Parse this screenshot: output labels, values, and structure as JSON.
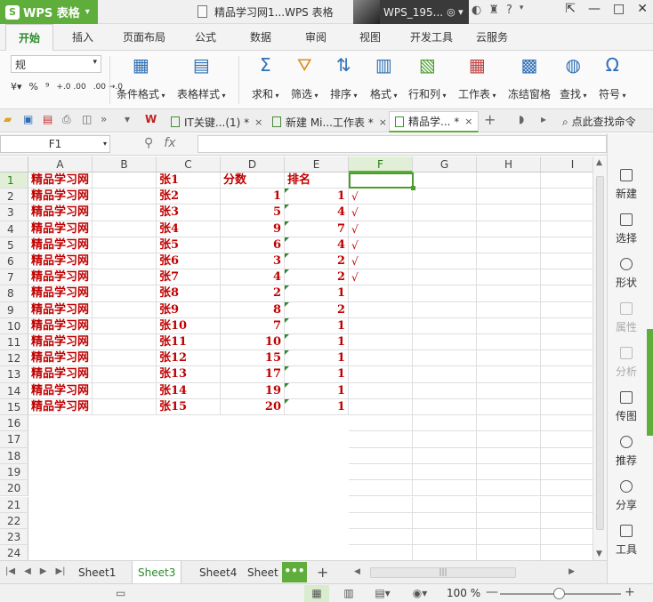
{
  "app": {
    "name": "WPS 表格",
    "doc_title": "精品学习网1...WPS 表格",
    "user": "WPS_195..."
  },
  "ribbon_tabs": [
    "开始",
    "插入",
    "页面布局",
    "公式",
    "数据",
    "审阅",
    "视图",
    "开发工具",
    "云服务"
  ],
  "ribbon": {
    "number_format": "规",
    "num_tools": [
      "%",
      "⁹",
      "+.0 .00",
      ".00 →.0"
    ],
    "buttons": [
      "条件格式",
      "表格样式",
      "求和",
      "筛选",
      "排序",
      "格式",
      "行和列",
      "工作表",
      "冻结窗格",
      "查找",
      "符号"
    ]
  },
  "doc_tabs": [
    {
      "label": "IT关键...(1) *",
      "close": "×"
    },
    {
      "label": "新建 Mi...工作表 *",
      "close": "×"
    },
    {
      "label": "精品学... *",
      "close": "×"
    }
  ],
  "search_cmd": "点此查找命令",
  "formula_bar": {
    "name_box": "F1",
    "fx": "fx",
    "value": ""
  },
  "columns": [
    "A",
    "B",
    "C",
    "D",
    "E",
    "F",
    "G",
    "H",
    "I"
  ],
  "selected_column": "F",
  "rows": [
    {
      "n": "1",
      "a": "精品学习网",
      "c": "张1",
      "d": "分数",
      "e": "排名",
      "f": ""
    },
    {
      "n": "2",
      "a": "精品学习网",
      "c": "张2",
      "d": "1",
      "e": "1",
      "f": "√"
    },
    {
      "n": "3",
      "a": "精品学习网",
      "c": "张3",
      "d": "5",
      "e": "4",
      "f": "√"
    },
    {
      "n": "4",
      "a": "精品学习网",
      "c": "张4",
      "d": "9",
      "e": "7",
      "f": "√"
    },
    {
      "n": "5",
      "a": "精品学习网",
      "c": "张5",
      "d": "6",
      "e": "4",
      "f": "√"
    },
    {
      "n": "6",
      "a": "精品学习网",
      "c": "张6",
      "d": "3",
      "e": "2",
      "f": "√"
    },
    {
      "n": "7",
      "a": "精品学习网",
      "c": "张7",
      "d": "4",
      "e": "2",
      "f": "√"
    },
    {
      "n": "8",
      "a": "精品学习网",
      "c": "张8",
      "d": "2",
      "e": "1",
      "f": ""
    },
    {
      "n": "9",
      "a": "精品学习网",
      "c": "张9",
      "d": "8",
      "e": "2",
      "f": ""
    },
    {
      "n": "10",
      "a": "精品学习网",
      "c": "张10",
      "d": "7",
      "e": "1",
      "f": ""
    },
    {
      "n": "11",
      "a": "精品学习网",
      "c": "张11",
      "d": "10",
      "e": "1",
      "f": ""
    },
    {
      "n": "12",
      "a": "精品学习网",
      "c": "张12",
      "d": "15",
      "e": "1",
      "f": ""
    },
    {
      "n": "13",
      "a": "精品学习网",
      "c": "张13",
      "d": "17",
      "e": "1",
      "f": ""
    },
    {
      "n": "14",
      "a": "精品学习网",
      "c": "张14",
      "d": "19",
      "e": "1",
      "f": ""
    },
    {
      "n": "15",
      "a": "精品学习网",
      "c": "张15",
      "d": "20",
      "e": "1",
      "f": ""
    },
    {
      "n": "16"
    },
    {
      "n": "17"
    },
    {
      "n": "18"
    },
    {
      "n": "19"
    },
    {
      "n": "20"
    },
    {
      "n": "21"
    },
    {
      "n": "22"
    },
    {
      "n": "23"
    },
    {
      "n": "24"
    }
  ],
  "side_panel": [
    "新建",
    "选择",
    "形状",
    "属性",
    "分析",
    "传图",
    "推荐",
    "分享",
    "工具"
  ],
  "sheets": [
    "Sheet1",
    "Sheet3",
    "Sheet4",
    "Sheet"
  ],
  "active_sheet": "Sheet3",
  "more_sheets": "•••",
  "add_sheet": "+",
  "status": {
    "zoom": "100 %"
  },
  "colors": {
    "accent": "#5fae3b",
    "cell_text": "#c00000"
  }
}
